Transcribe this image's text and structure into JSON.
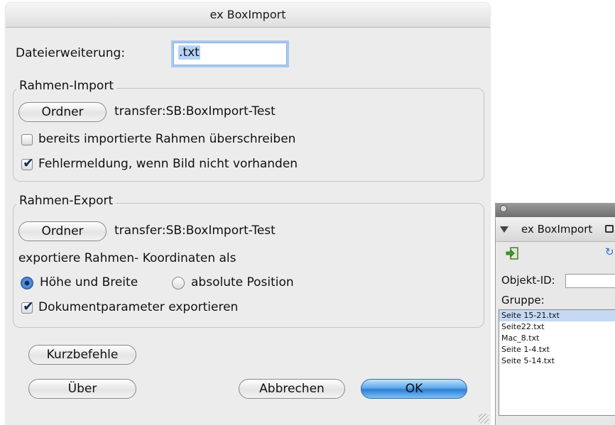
{
  "dialog": {
    "title": "ex BoxImport",
    "extension_label": "Dateierweiterung:",
    "extension_value": ".txt",
    "import_group": {
      "title": "Rahmen-Import",
      "folder_button": "Ordner",
      "folder_path": "transfer:SB:BoxImport-Test",
      "overwrite_label": "bereits importierte Rahmen überschreiben",
      "overwrite_checked": false,
      "error_label": "Fehlermeldung, wenn Bild nicht vorhanden",
      "error_checked": true
    },
    "export_group": {
      "title": "Rahmen-Export",
      "folder_button": "Ordner",
      "folder_path": "transfer:SB:BoxImport-Test",
      "coords_label": "exportiere Rahmen- Koordinaten als",
      "radio_size_label": "Höhe und Breite",
      "radio_position_label": "absolute Position",
      "selected_radio": "Höhe und Breite",
      "docparams_label": "Dokumentparameter exportieren",
      "docparams_checked": true
    },
    "buttons": {
      "shortcuts": "Kurzbefehle",
      "about": "Über",
      "cancel": "Abbrechen",
      "ok": "OK"
    }
  },
  "palette": {
    "title": "ex BoxImport",
    "object_id_label": "Objekt-ID:",
    "object_id_value": "",
    "group_label": "Gruppe:",
    "files": [
      "Seite 15-21.txt",
      "Seite22.txt",
      "Mac_8.txt",
      "Seite 1-4.txt",
      "Seite 5-14.txt"
    ],
    "selected_file": "Seite 15-21.txt"
  },
  "colors": {
    "dialog_bg": "#ececec",
    "default_button": "#4a98e4",
    "selection": "#c5d9f4"
  }
}
